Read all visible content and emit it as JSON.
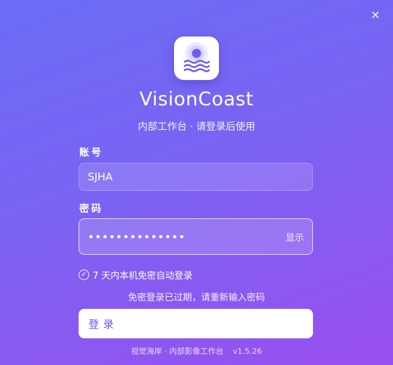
{
  "window": {
    "close_glyph": "✕"
  },
  "brand": {
    "logo_icon": "sun-over-waves-icon",
    "app_name": "VisionCoast",
    "subtitle": "内部工作台 · 请登录后使用"
  },
  "account": {
    "label": "账号",
    "value": "SJHA"
  },
  "password": {
    "label": "密码",
    "masked_value": "••••••••••••••",
    "show_label": "显示"
  },
  "remember": {
    "checked": true,
    "check_glyph": "✓",
    "label": "7 天内本机免密自动登录"
  },
  "error_message": "免密登录已过期，请重新输入密码",
  "login_button": {
    "label": "登录"
  },
  "footer": {
    "text": "视觉海岸 · 内部影像工作台",
    "version": "v1.5.26"
  },
  "colors": {
    "gradient_start": "#6a6cf5",
    "gradient_end": "#9a4ff0",
    "logo_accent": "#6a5cf0",
    "button_text": "#6d55d8"
  }
}
